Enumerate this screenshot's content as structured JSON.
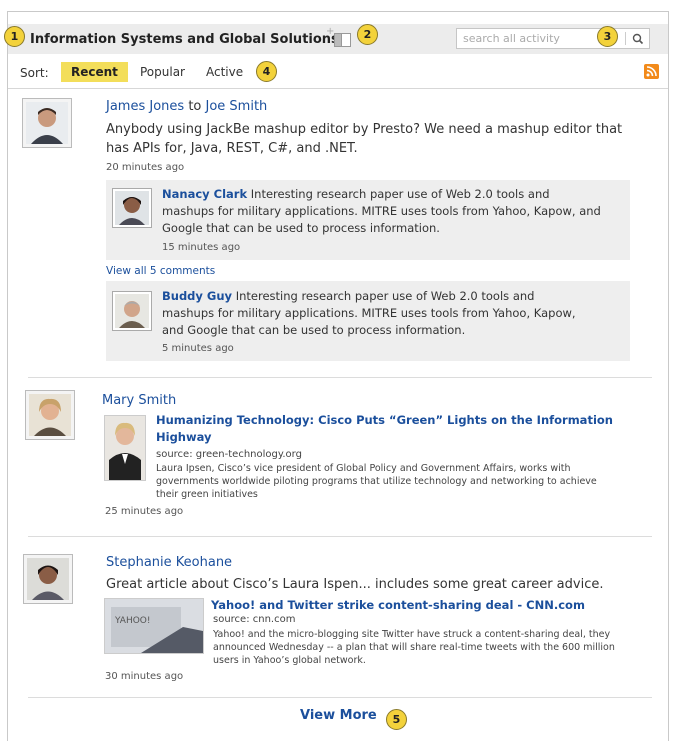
{
  "header": {
    "title": "Information Systems and Global Solutions",
    "search_placeholder": "search all activity"
  },
  "callouts": [
    "1",
    "2",
    "3",
    "4",
    "5"
  ],
  "sort": {
    "label": "Sort:",
    "tabs": [
      {
        "label": "Recent",
        "active": true
      },
      {
        "label": "Popular",
        "active": false
      },
      {
        "label": "Active",
        "active": false
      }
    ]
  },
  "colors": {
    "link": "#1b4f9c",
    "highlight": "#f3de5a",
    "callout": "#f3d23b",
    "rss": "#f28a1a"
  },
  "feed": [
    {
      "author": "James Jones",
      "connector": "to",
      "target": "Joe Smith",
      "text": "Anybody using JackBe mashup editor by Presto? We need a mashup editor that has APIs for, Java, REST, C#, and .NET.",
      "time": "20 minutes ago",
      "comments": [
        {
          "author": "Nanacy Clark",
          "text": "Interesting research paper use of Web 2.0 tools and mashups for military applications. MITRE uses tools from Yahoo, Kapow, and Google that can be used to process information.",
          "time": "15 minutes ago"
        },
        {
          "author": "Buddy Guy",
          "text": "Interesting research paper use of Web 2.0 tools and mashups for military applications. MITRE uses tools from Yahoo, Kapow, and Google that can be used to process information.",
          "time": "5 minutes ago"
        }
      ],
      "view_all": "View all 5 comments"
    },
    {
      "author": "Mary Smith",
      "article": {
        "title": "Humanizing Technology: Cisco Puts “Green” Lights on the Information Highway",
        "source": "source: green-technology.org",
        "desc": "Laura Ipsen, Cisco’s vice president of Global Policy and Government Affairs, works with governments worldwide piloting programs that utilize technology and networking to achieve their green initiatives"
      },
      "time": "25 minutes ago"
    },
    {
      "author": "Stephanie Keohane",
      "text": "Great article about Cisco’s Laura Ispen... includes some great career advice.",
      "article": {
        "title": "Yahoo! and Twitter strike content-sharing deal - CNN.com",
        "source": "source: cnn.com",
        "desc": "Yahoo! and the micro-blogging site Twitter have struck a content-sharing deal, they announced Wednesday -- a plan that will share real-time tweets with the 600 million users in Yahoo’s global network."
      },
      "time": "30 minutes ago"
    }
  ],
  "view_more": "View More"
}
